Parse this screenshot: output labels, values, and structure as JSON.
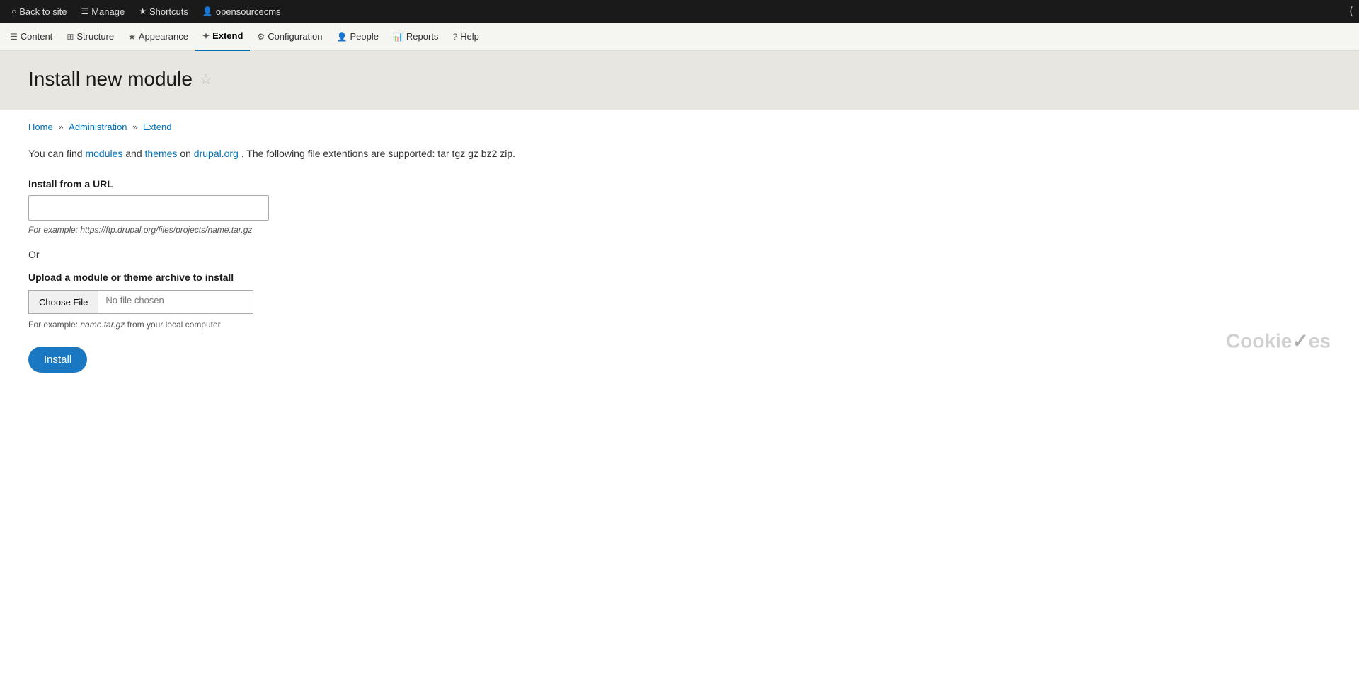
{
  "adminBar": {
    "backToSite": "Back to site",
    "manage": "Manage",
    "shortcuts": "Shortcuts",
    "user": "opensourcecms"
  },
  "navBar": {
    "items": [
      {
        "id": "content",
        "label": "Content",
        "icon": "☰"
      },
      {
        "id": "structure",
        "label": "Structure",
        "icon": "⊞"
      },
      {
        "id": "appearance",
        "label": "Appearance",
        "icon": "★"
      },
      {
        "id": "extend",
        "label": "Extend",
        "icon": "✦",
        "active": true
      },
      {
        "id": "configuration",
        "label": "Configuration",
        "icon": "⚙"
      },
      {
        "id": "people",
        "label": "People",
        "icon": "👤"
      },
      {
        "id": "reports",
        "label": "Reports",
        "icon": "📊"
      },
      {
        "id": "help",
        "label": "Help",
        "icon": "?"
      }
    ]
  },
  "page": {
    "title": "Install new module",
    "breadcrumb": {
      "home": "Home",
      "administration": "Administration",
      "extend": "Extend"
    },
    "description": "You can find",
    "modulesLink": "modules",
    "andText": " and ",
    "themesLink": "themes",
    "onText": " on ",
    "drupalLink": "drupal.org",
    "extensionsText": ". The following file extentions are supported: tar tgz gz bz2 zip.",
    "installFromUrl": {
      "label": "Install from a URL",
      "placeholder": "",
      "exampleLabel": "For example: ",
      "exampleUrl": "https://ftp.drupal.org/files/projects/name.tar.gz"
    },
    "orDivider": "Or",
    "uploadSection": {
      "label": "Upload a module or theme archive to install",
      "chooseFileBtn": "Choose File",
      "fileNamePlaceholder": "No file chosen",
      "exampleLabel": "For example: ",
      "exampleFile": "name.tar.gz",
      "exampleSuffix": " from your local computer"
    },
    "installBtn": "Install"
  },
  "watermark": {
    "text": "CookieYes"
  }
}
